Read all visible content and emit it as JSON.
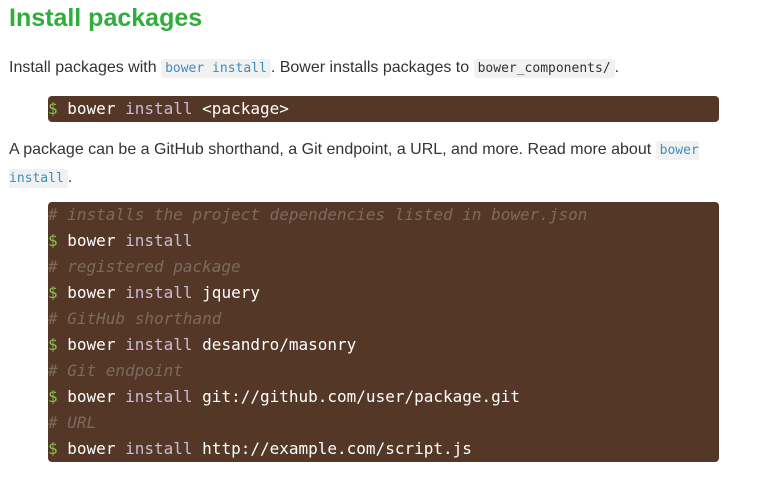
{
  "heading": "Install packages",
  "para1": {
    "text_before": "Install packages with ",
    "code1": "bower install",
    "text_middle": ". Bower installs packages to ",
    "code2": "bower_components/",
    "text_after": "."
  },
  "snippet1": {
    "prompt": "$",
    "cmd": "bower",
    "sub": "install",
    "arg": "<package>"
  },
  "para2": {
    "text_before": "A package can be a GitHub shorthand, a Git endpoint, a URL, and more. Read more about ",
    "code": "bower install",
    "text_after": "."
  },
  "snippet2": {
    "lines": [
      {
        "kind": "comment",
        "text": "# installs the project dependencies listed in bower.json"
      },
      {
        "kind": "cmd",
        "prompt": "$",
        "cmd": "bower",
        "sub": "install",
        "arg": ""
      },
      {
        "kind": "comment",
        "text": "# registered package"
      },
      {
        "kind": "cmd",
        "prompt": "$",
        "cmd": "bower",
        "sub": "install",
        "arg": "jquery"
      },
      {
        "kind": "comment",
        "text": "# GitHub shorthand"
      },
      {
        "kind": "cmd",
        "prompt": "$",
        "cmd": "bower",
        "sub": "install",
        "arg": "desandro/masonry"
      },
      {
        "kind": "comment",
        "text": "# Git endpoint"
      },
      {
        "kind": "cmd",
        "prompt": "$",
        "cmd": "bower",
        "sub": "install",
        "arg": "git://github.com/user/package.git"
      },
      {
        "kind": "comment",
        "text": "# URL"
      },
      {
        "kind": "cmd",
        "prompt": "$",
        "cmd": "bower",
        "sub": "install",
        "arg": "http://example.com/script.js"
      }
    ]
  },
  "colors": {
    "heading": "#2fae3c",
    "code_bg": "#543727",
    "prompt": "#8bc34a",
    "comment": "#7d6a5e",
    "keyword": "#c9bcd5",
    "inline_code_link": "#3c8dbc"
  }
}
